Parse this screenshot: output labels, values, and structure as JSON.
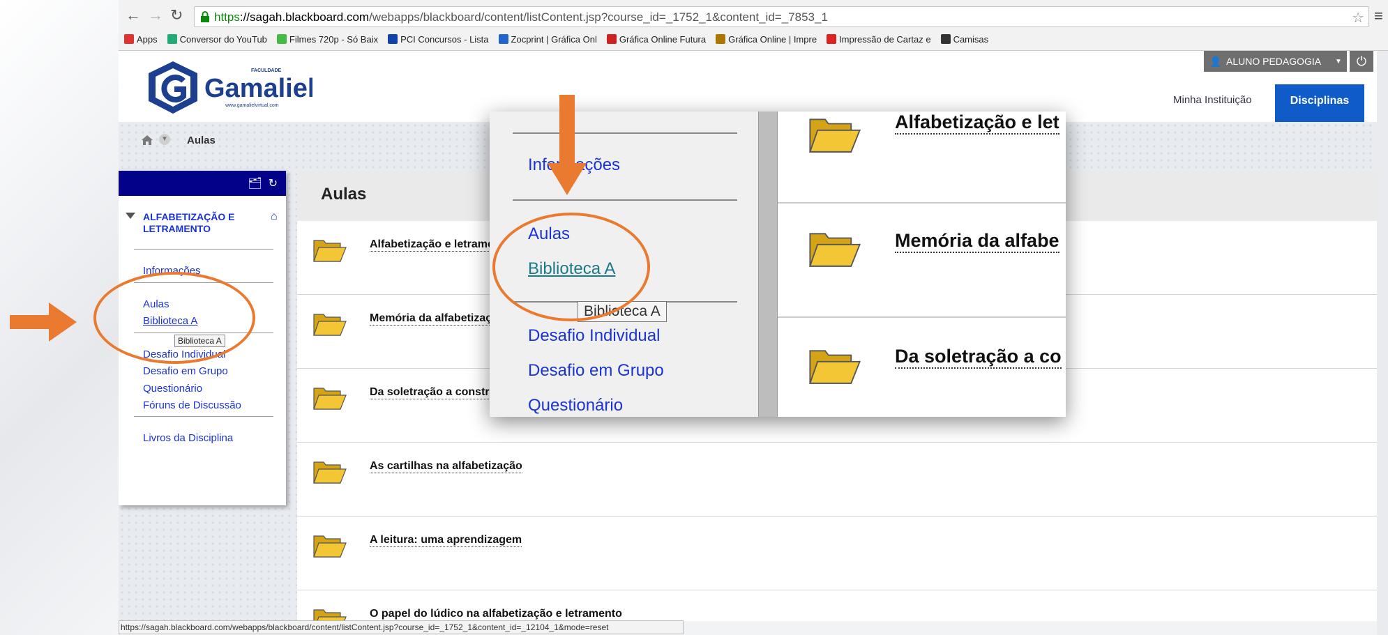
{
  "browser": {
    "url_scheme": "https",
    "url_host": "://sagah.blackboard.com",
    "url_path": "/webapps/blackboard/content/listContent.jsp?course_id=_1752_1&content_id=_7853_1",
    "bookmarks": [
      {
        "label": "Apps",
        "icon": "apps-grid-icon",
        "color": "#d33"
      },
      {
        "label": "Conversor do YouTub",
        "icon": "conversor-icon",
        "color": "#2a7"
      },
      {
        "label": "Filmes 720p - Só Baix",
        "icon": "filmes-icon",
        "color": "#4b4"
      },
      {
        "label": "PCI Concursos - Lista",
        "icon": "pci-icon",
        "color": "#14a"
      },
      {
        "label": "Zocprint | Gráfica Onl",
        "icon": "zocprint-icon",
        "color": "#26c"
      },
      {
        "label": "Gráfica Online Futura",
        "icon": "futura-icon",
        "color": "#c22"
      },
      {
        "label": "Gráfica Online | Impre",
        "icon": "grafica-icon",
        "color": "#a70"
      },
      {
        "label": "Impressão de Cartaz e",
        "icon": "cartaz-icon",
        "color": "#d22"
      },
      {
        "label": "Camisas",
        "icon": "camisas-icon",
        "color": "#333"
      }
    ]
  },
  "header": {
    "logo_small": "FACULDADE",
    "logo_name": "Gamaliel",
    "logo_url": "www.gamalielvirtual.com",
    "user_label": "ALUNO PEDAGOGIA",
    "institution_link": "Minha Instituição",
    "disciplines_tab": "Disciplinas"
  },
  "breadcrumb": {
    "current": "Aulas"
  },
  "course_menu": {
    "title": "ALFABETIZAÇÃO E LETRAMENTO",
    "items": [
      {
        "label": "Informações"
      },
      {
        "label": "Aulas"
      },
      {
        "label": "Biblioteca A"
      },
      {
        "label": "Desafio Individual"
      },
      {
        "label": "Desafio em Grupo"
      },
      {
        "label": "Questionário"
      },
      {
        "label": "Fóruns de Discussão"
      },
      {
        "label": "Livros da Disciplina"
      }
    ],
    "tooltip": "Biblioteca A"
  },
  "content": {
    "title": "Aulas",
    "items": [
      {
        "title": "Alfabetização e letramento"
      },
      {
        "title": "Memória da alfabetização"
      },
      {
        "title": "Da soletração a construção"
      },
      {
        "title": "As cartilhas na alfabetização"
      },
      {
        "title": "A leitura: uma aprendizagem"
      },
      {
        "title": "O papel do lúdico na alfabetização e letramento"
      }
    ]
  },
  "zoom_inset": {
    "menu": [
      "Informações",
      "Aulas",
      "Biblioteca A",
      "Desafio Individual",
      "Desafio em Grupo",
      "Questionário"
    ],
    "items": [
      "Alfabetização e let",
      "Memória da alfabe",
      "Da soletração a co"
    ],
    "tooltip": "Biblioteca A"
  },
  "status_url": "https://sagah.blackboard.com/webapps/blackboard/content/listContent.jsp?course_id=_1752_1&content_id=_12104_1&mode=reset",
  "colors": {
    "accent": "#0f5cc8",
    "menu_header": "#03018a",
    "link": "#1a33d6",
    "annotation": "#ea7a30"
  }
}
